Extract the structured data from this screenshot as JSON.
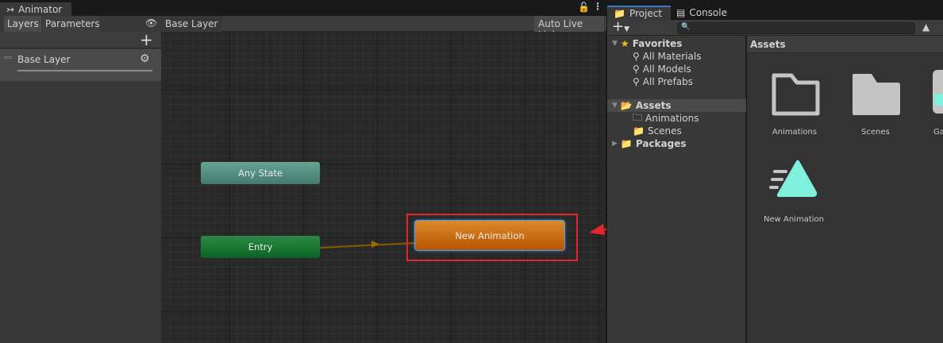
{
  "animator": {
    "tab_title": "Animator",
    "tab_icon": "animator-icon",
    "layers_tab": "Layers",
    "parameters_tab": "Parameters",
    "breadcrumb": "Base Layer",
    "auto_live_link": "Auto Live Link",
    "layer_name": "Base Layer",
    "states": {
      "any_state": "Any State",
      "entry": "Entry",
      "new_animation": "New Animation"
    },
    "colors": {
      "any_state": "#4f8a7f",
      "entry": "#1a7a35",
      "new_animation": "#d2780f",
      "highlight": "#e8242b"
    }
  },
  "project": {
    "tabs": [
      "Project",
      "Console"
    ],
    "search_placeholder": "",
    "favorites": {
      "label": "Favorites",
      "items": [
        "All Materials",
        "All Models",
        "All Prefabs"
      ]
    },
    "assets": {
      "label": "Assets",
      "children": [
        "Animations",
        "Scenes"
      ]
    },
    "packages": "Packages",
    "grid_header": "Assets",
    "grid_items": [
      "Animations",
      "Scenes",
      "Ga",
      "New Animation"
    ]
  }
}
